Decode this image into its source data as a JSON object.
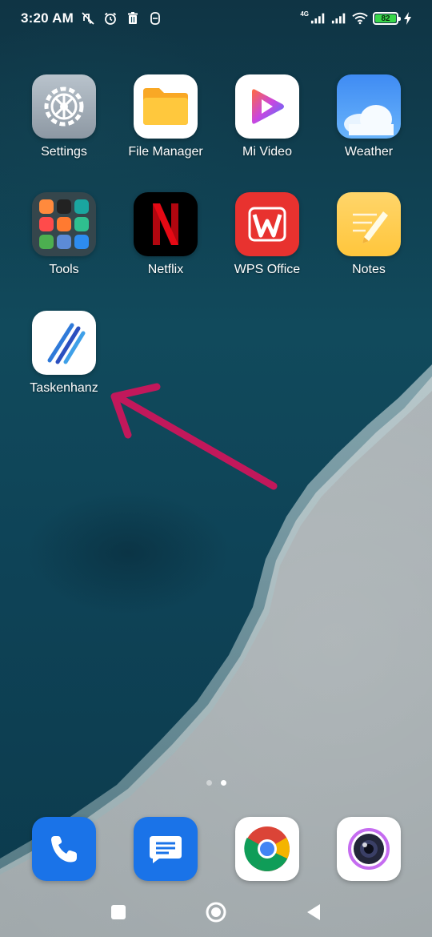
{
  "status_bar": {
    "time": "3:20 AM",
    "network_type": "4G",
    "battery_level": "82",
    "icons": [
      "mute-icon",
      "alarm-icon",
      "trash-icon",
      "notification-icon",
      "signal-4g-icon",
      "signal-icon",
      "wifi-icon",
      "battery-icon",
      "charging-icon"
    ]
  },
  "apps": [
    {
      "label": "Settings",
      "icon": "settings-gear-icon"
    },
    {
      "label": "File Manager",
      "icon": "folder-icon"
    },
    {
      "label": "Mi Video",
      "icon": "play-icon"
    },
    {
      "label": "Weather",
      "icon": "cloud-icon"
    },
    {
      "label": "Tools",
      "icon": "folder-grid-icon"
    },
    {
      "label": "Netflix",
      "icon": "netflix-n-icon"
    },
    {
      "label": "WPS Office",
      "icon": "wps-w-icon"
    },
    {
      "label": "Notes",
      "icon": "pencil-note-icon"
    },
    {
      "label": "Taskenhanz",
      "icon": "diagonal-stripes-icon"
    }
  ],
  "dock": [
    {
      "icon": "phone-icon"
    },
    {
      "icon": "messages-icon"
    },
    {
      "icon": "chrome-icon"
    },
    {
      "icon": "camera-icon"
    }
  ],
  "page_indicator": {
    "pages": 2,
    "current": 2
  },
  "annotation": {
    "type": "arrow",
    "color": "#c2185b",
    "points_to": "Taskenhanz"
  },
  "nav_bar": {
    "buttons": [
      "recents-square-icon",
      "home-circle-icon",
      "back-triangle-icon"
    ]
  }
}
